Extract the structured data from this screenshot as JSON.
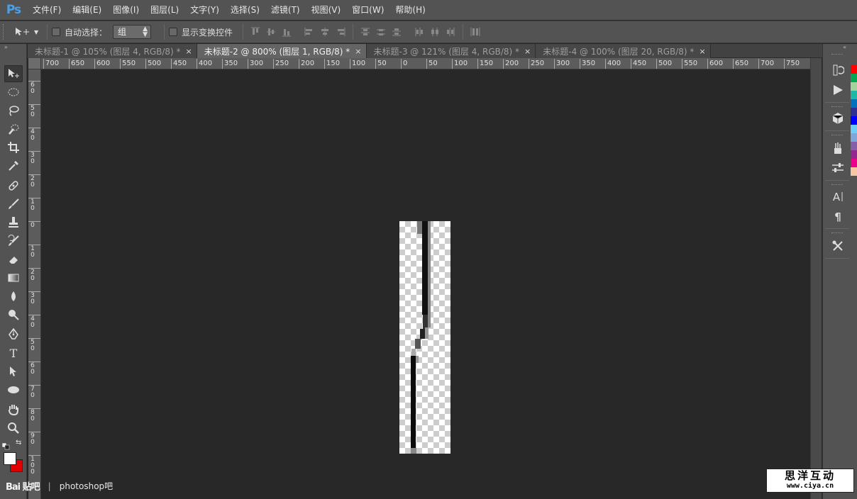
{
  "app": {
    "logo": "Ps"
  },
  "menu": [
    "文件(F)",
    "编辑(E)",
    "图像(I)",
    "图层(L)",
    "文字(Y)",
    "选择(S)",
    "滤镜(T)",
    "视图(V)",
    "窗口(W)",
    "帮助(H)"
  ],
  "options": {
    "auto_select_label": "自动选择：",
    "auto_select_value": "组",
    "show_transform_label": "显示变换控件"
  },
  "tabs": [
    {
      "label": "未标题-1 @ 105% (图层 4, RGB/8) *",
      "close": "×",
      "active": false
    },
    {
      "label": "未标题-2 @ 800% (图层 1, RGB/8) *",
      "close": "×",
      "active": true
    },
    {
      "label": "未标题-3 @ 121% (图层 4, RGB/8) *",
      "close": "×",
      "active": false
    },
    {
      "label": "未标题-4 @ 100% (图层 20, RGB/8) *",
      "close": "×",
      "active": false
    }
  ],
  "ruler_top": [
    "700",
    "650",
    "600",
    "550",
    "500",
    "450",
    "400",
    "350",
    "300",
    "250",
    "200",
    "150",
    "100",
    "50",
    "0",
    "50",
    "100",
    "150",
    "200",
    "250",
    "300",
    "350",
    "400",
    "450",
    "500",
    "550",
    "600",
    "650",
    "700",
    "750"
  ],
  "ruler_left": [
    "6\n0",
    "5\n0",
    "4\n0",
    "3\n0",
    "2\n0",
    "1\n0",
    "0",
    "1\n0",
    "2\n0",
    "3\n0",
    "4\n0",
    "5\n0",
    "6\n0",
    "7\n0",
    "8\n0",
    "9\n0",
    "1\n0\n0"
  ],
  "colors": {
    "foreground": "#ffffff",
    "background": "#e00000",
    "ps_blue": "#4aa0e8"
  },
  "swatches": [
    "#ff0000",
    "#00a651",
    "#a3d39c",
    "#1fb7a6",
    "#0072bc",
    "#2e3192",
    "#0000ff",
    "#6dcff6",
    "#7da7d9",
    "#8560a8",
    "#92278f",
    "#ec008c",
    "#f7c6a3"
  ],
  "watermark": {
    "logo": "Bai 贴吧",
    "sep": "|",
    "text": "photoshop吧"
  },
  "stamp": {
    "title": "思洋互动",
    "url": "www.ciya.cn"
  }
}
